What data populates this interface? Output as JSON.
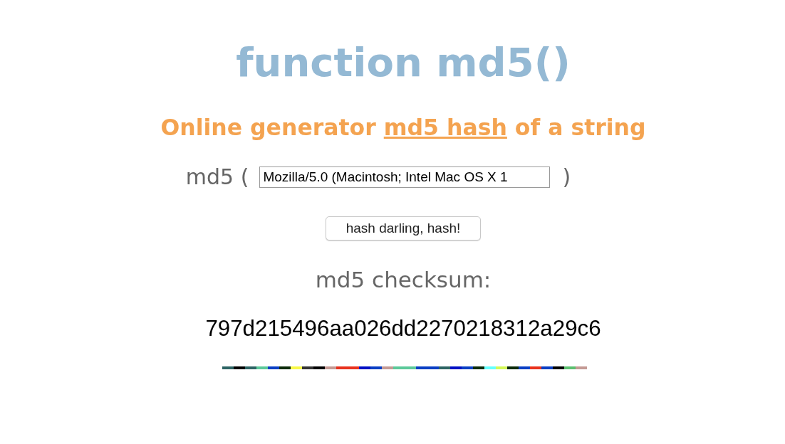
{
  "title": "function md5()",
  "subtitle": {
    "before": "Online generator",
    "link": "md5 hash",
    "after": "of a string"
  },
  "input_row": {
    "prefix": "md5 (",
    "value": "Mozilla/5.0 (Macintosh; Intel Mac OS X 1",
    "suffix": ")"
  },
  "button": "hash darling, hash!",
  "result": {
    "label": "md5 checksum:",
    "checksum": "797d215496aa026dd2270218312a29c6"
  },
  "color_strip": [
    {
      "color": "#2d6464"
    },
    {
      "color": "#000000"
    },
    {
      "color": "#2d6464"
    },
    {
      "color": "#5cc99a"
    },
    {
      "color": "#0a3fc4"
    },
    {
      "color": "#0c2b0a"
    },
    {
      "color": "#f8f848"
    },
    {
      "color": "#333333"
    },
    {
      "color": "#000000"
    },
    {
      "color": "#c49a94"
    },
    {
      "color": "#e8321e"
    },
    {
      "color": "#e8321e"
    },
    {
      "color": "#0011c4"
    },
    {
      "color": "#0a3fc4"
    },
    {
      "color": "#c49a94"
    },
    {
      "color": "#5cc99a"
    },
    {
      "color": "#5cc99a"
    },
    {
      "color": "#0a3fc4"
    },
    {
      "color": "#0a3fc4"
    },
    {
      "color": "#2d6464"
    },
    {
      "color": "#0011c4"
    },
    {
      "color": "#0a3fc4"
    },
    {
      "color": "#0c2b0a"
    },
    {
      "color": "#66ffff"
    },
    {
      "color": "#d4f858"
    },
    {
      "color": "#0c2b0a"
    },
    {
      "color": "#0a3fc4"
    },
    {
      "color": "#e8321e"
    },
    {
      "color": "#0a3fc4"
    },
    {
      "color": "#000000"
    },
    {
      "color": "#5cc070"
    },
    {
      "color": "#c49a94"
    }
  ]
}
